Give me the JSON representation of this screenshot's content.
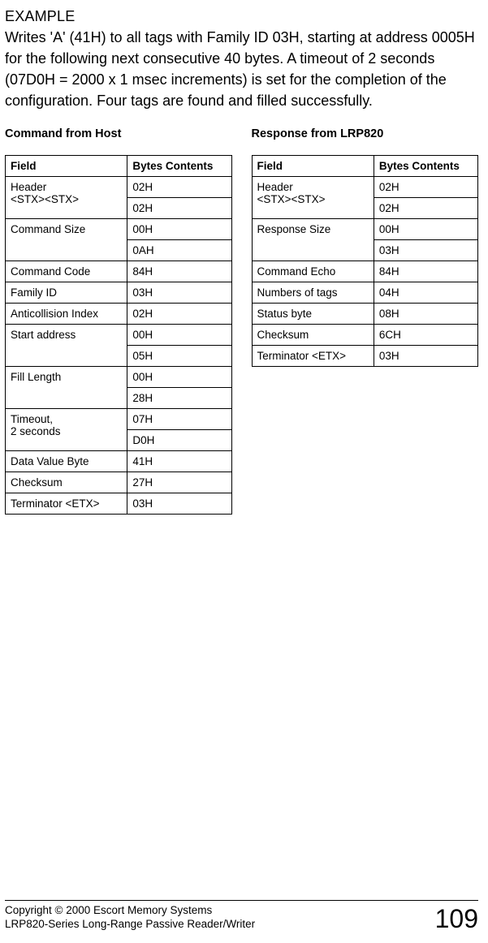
{
  "example": {
    "heading": "EXAMPLE",
    "body": "Writes 'A' (41H) to all tags with Family ID 03H, starting at address 0005H for the following next consecutive 40 bytes. A timeout of 2 seconds (07D0H = 2000 x 1 msec increments) is set for the completion of the configuration. Four tags are found and filled successfully."
  },
  "command_table": {
    "title": "Command from Host",
    "header_field": "Field",
    "header_bytes": "Bytes Contents",
    "rows": [
      {
        "field": "Header\n<STX><STX>",
        "bytes": [
          "02H",
          "02H"
        ]
      },
      {
        "field": "Command Size",
        "bytes": [
          "00H",
          "0AH"
        ]
      },
      {
        "field": "Command Code",
        "bytes": [
          "84H"
        ]
      },
      {
        "field": "Family ID",
        "bytes": [
          "03H"
        ]
      },
      {
        "field": "Anticollision Index",
        "bytes": [
          "02H"
        ]
      },
      {
        "field": "Start address",
        "bytes": [
          "00H",
          "05H"
        ]
      },
      {
        "field": "Fill Length",
        "bytes": [
          "00H",
          "28H"
        ]
      },
      {
        "field": "Timeout,\n2 seconds",
        "bytes": [
          "07H",
          "D0H"
        ]
      },
      {
        "field": "Data Value Byte",
        "bytes": [
          "41H"
        ]
      },
      {
        "field": "Checksum",
        "bytes": [
          "27H"
        ]
      },
      {
        "field": "Terminator <ETX>",
        "bytes": [
          "03H"
        ]
      }
    ]
  },
  "response_table": {
    "title": "Response from LRP820",
    "header_field": "Field",
    "header_bytes": "Bytes Contents",
    "rows": [
      {
        "field": "Header\n<STX><STX>",
        "bytes": [
          "02H",
          "02H"
        ]
      },
      {
        "field": "Response Size",
        "bytes": [
          "00H",
          "03H"
        ]
      },
      {
        "field": "Command Echo",
        "bytes": [
          "84H"
        ]
      },
      {
        "field": "Numbers of tags",
        "bytes": [
          "04H"
        ]
      },
      {
        "field": "Status byte",
        "bytes": [
          "08H"
        ]
      },
      {
        "field": "Checksum",
        "bytes": [
          "6CH"
        ]
      },
      {
        "field": "Terminator <ETX>",
        "bytes": [
          "03H"
        ]
      }
    ]
  },
  "footer": {
    "copyright": "Copyright © 2000 Escort Memory Systems",
    "product": "LRP820-Series Long-Range Passive Reader/Writer",
    "page_number": "109"
  }
}
